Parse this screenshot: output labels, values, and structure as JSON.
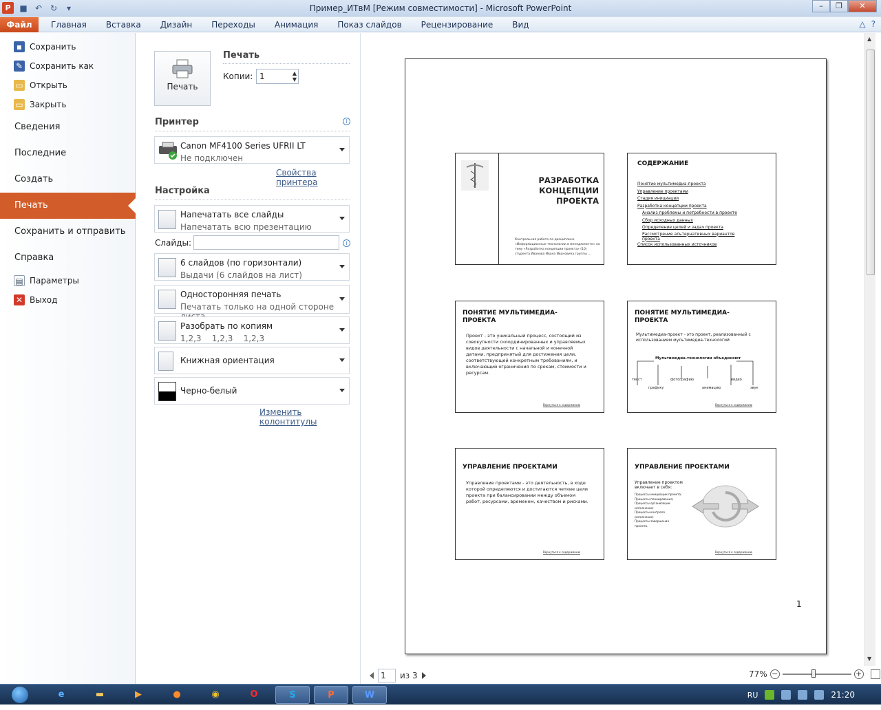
{
  "window": {
    "title": "Пример_ИТвМ [Режим совместимости]  -  Microsoft PowerPoint",
    "app_icon": "P"
  },
  "ribbon": {
    "file_tab": "Файл",
    "tabs": [
      "Главная",
      "Вставка",
      "Дизайн",
      "Переходы",
      "Анимация",
      "Показ слайдов",
      "Рецензирование",
      "Вид"
    ]
  },
  "nav": {
    "save": "Сохранить",
    "save_as": "Сохранить как",
    "open": "Открыть",
    "close": "Закрыть",
    "info": "Сведения",
    "recent": "Последние",
    "new": "Создать",
    "print": "Печать",
    "save_send": "Сохранить и отправить",
    "help": "Справка",
    "options": "Параметры",
    "exit": "Выход"
  },
  "print": {
    "button_label": "Печать",
    "section_title": "Печать",
    "copies_label": "Копии:",
    "copies_value": "1"
  },
  "printer": {
    "heading": "Принтер",
    "name": "Canon MF4100 Series UFRII LT",
    "status": "Не подключен",
    "properties_link": "Свойства принтера"
  },
  "settings": {
    "heading": "Настройка",
    "range": {
      "title": "Напечатать все слайды",
      "subtitle": "Напечатать всю презентацию"
    },
    "slides_label": "Слайды:",
    "layout": {
      "title": "6 слайдов (по горизонтали)",
      "subtitle": "Выдачи (6 слайдов на лист)"
    },
    "sides": {
      "title": "Односторонняя печать",
      "subtitle": "Печатать только на одной стороне листа"
    },
    "collate": {
      "title": "Разобрать по копиям",
      "subtitle": "1,2,3    1,2,3    1,2,3"
    },
    "orientation": {
      "title": "Книжная ориентация"
    },
    "color": {
      "title": "Черно-белый"
    },
    "headers_link": "Изменить колонтитулы"
  },
  "preview": {
    "page_number": "1",
    "slides": [
      {
        "title": "РАЗРАБОТКА КОНЦЕПЦИИ ПРОЕКТА",
        "body": "Контрольная работа по дисциплине «Информационные технологии в менеджменте» на тему «Разработка концепции проекта» (10) студента Иванова Ивана Ивановича группы ..."
      },
      {
        "title": "СОДЕРЖАНИЕ",
        "items": [
          "Понятие мультимедиа-проекта",
          "Управление проектами",
          "Стадия инициации",
          "Разработка концепции проекта",
          "Анализ проблемы и потребности в проекте",
          "Сбор исходных данных",
          "Определение целей и задач проекта",
          "Рассмотрение альтернативных вариантов проекта",
          "Список использованных источников"
        ]
      },
      {
        "title": "ПОНЯТИЕ МУЛЬТИМЕДИА-ПРОЕКТА",
        "body": "Проект - это уникальный процесс, состоящий из совокупности скоординированных и управляемых видов деятельности с начальной и конечной датами, предпринятый для достижения цели, соответствующей конкретным требованиям, и включающий ограничения по срокам, стоимости и ресурсам.",
        "footer": "Вернуться к содержанию"
      },
      {
        "title": "ПОНЯТИЕ МУЛЬТИМЕДИА-ПРОЕКТА",
        "body": "Мультимедиа-проект - это проект, реализованный с использованием мультимедиа-технологий",
        "diagram_title": "Мультимедиа-технологии объединяют",
        "diagram_items": [
          "текст",
          "графику",
          "фотографию",
          "анимацию",
          "видео",
          "звук"
        ],
        "footer": "Вернуться к содержанию"
      },
      {
        "title": "УПРАВЛЕНИЕ ПРОЕКТАМИ",
        "body": "Управление проектами - это деятельность, в ходе которой определяются и достигаются четкие цели проекта при балансировании между объемом работ, ресурсами, временем, качеством и рисками.",
        "footer": "Вернуться к содержанию"
      },
      {
        "title": "УПРАВЛЕНИЕ ПРОЕКТАМИ",
        "body": "Управление проектом включает в себя:",
        "items": [
          "Процессы инициации проекта;",
          "Процессы планирования;",
          "Процессы организации исполнения;",
          "Процессы контроля исполнения;",
          "Процессы завершения проекта."
        ],
        "footer": "Вернуться к содержанию"
      }
    ]
  },
  "pager": {
    "current": "1",
    "of_total": "из 3"
  },
  "zoom": {
    "level": "77%",
    "fraction": 0.45
  },
  "taskbar": {
    "lang": "RU",
    "time": "21:20"
  }
}
